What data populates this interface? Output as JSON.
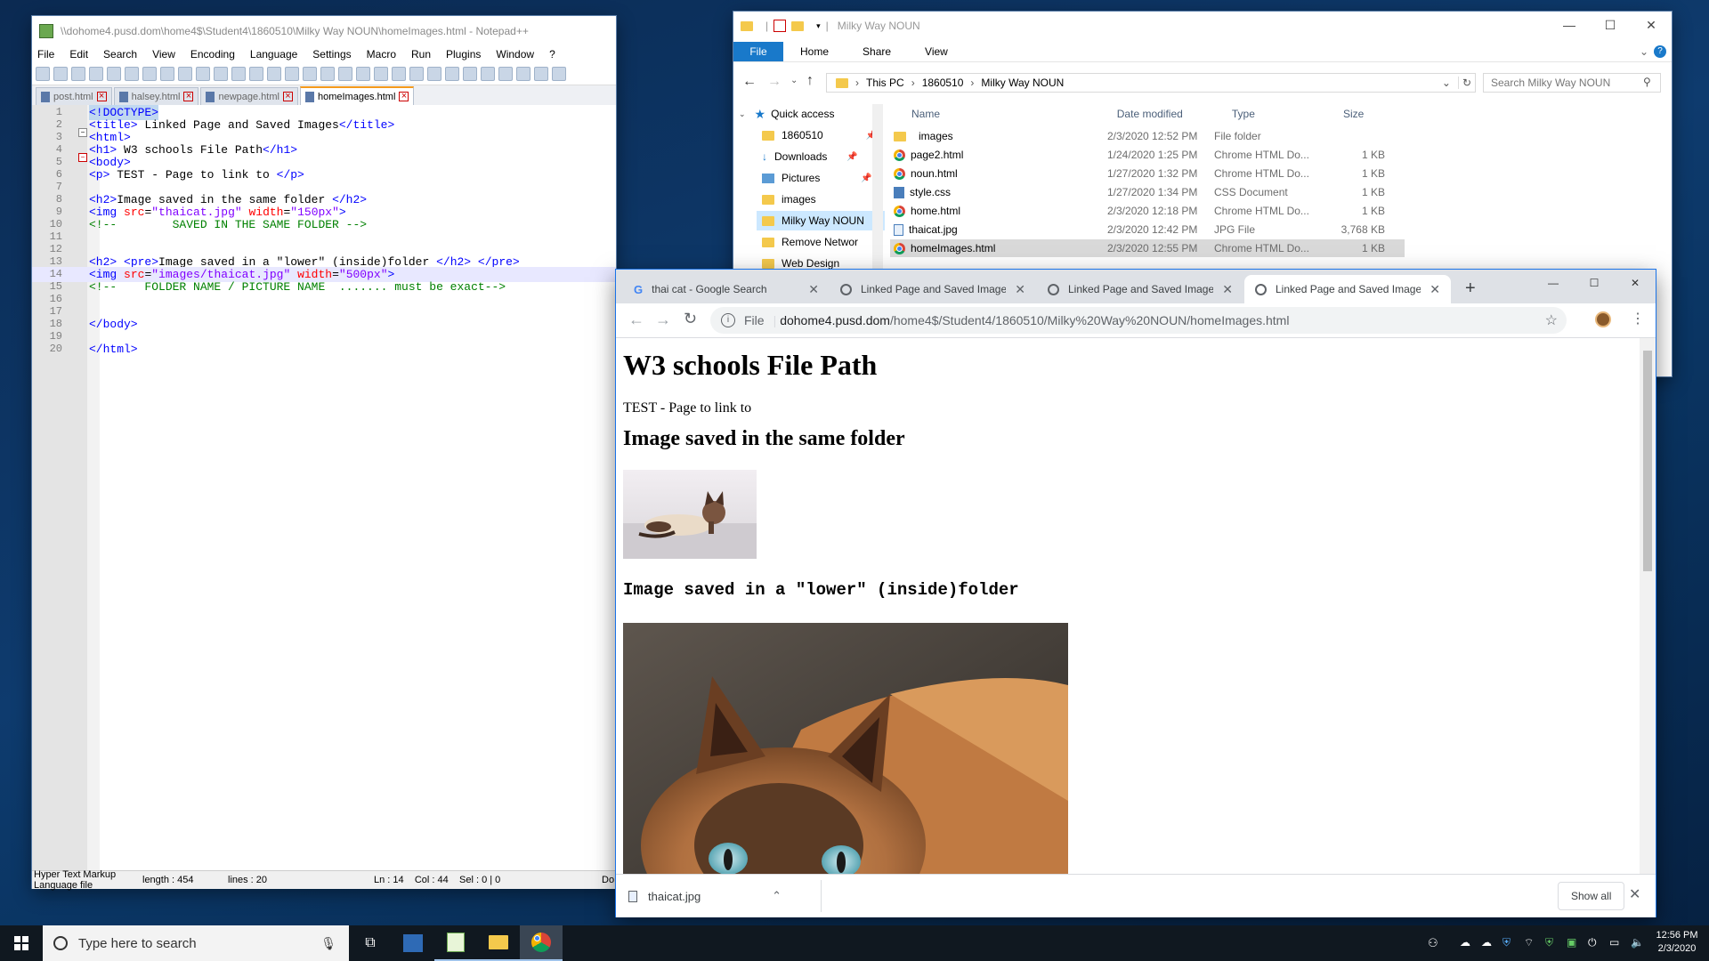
{
  "notepad": {
    "title": "\\\\dohome4.pusd.dom\\home4$\\Student4\\1860510\\Milky Way NOUN\\homeImages.html - Notepad++",
    "menu": [
      "File",
      "Edit",
      "Search",
      "View",
      "Encoding",
      "Language",
      "Settings",
      "Macro",
      "Run",
      "Plugins",
      "Window",
      "?"
    ],
    "tabs": [
      "post.html",
      "halsey.html",
      "newpage.html",
      "homeImages.html"
    ],
    "lines": [
      {
        "n": "1"
      },
      {
        "n": "2"
      },
      {
        "n": "3"
      },
      {
        "n": "4"
      },
      {
        "n": "5"
      },
      {
        "n": "6"
      },
      {
        "n": "7"
      },
      {
        "n": "8"
      },
      {
        "n": "9"
      },
      {
        "n": "10"
      },
      {
        "n": "11"
      },
      {
        "n": "12"
      },
      {
        "n": "13"
      },
      {
        "n": "14"
      },
      {
        "n": "15"
      },
      {
        "n": "16"
      },
      {
        "n": "17"
      },
      {
        "n": "18"
      },
      {
        "n": "19"
      },
      {
        "n": "20"
      }
    ],
    "code": {
      "l1": "<!DOCTYPE>",
      "l2_open": "<title>",
      "l2_text": " Linked Page and Saved Images",
      "l2_close": "</title>",
      "l3": "<html>",
      "l4_open": "<h1>",
      "l4_text": " W3 schools File Path",
      "l4_close": "</h1>",
      "l5": "<body>",
      "l6_open": "<p>",
      "l6_text": " TEST - Page to link to ",
      "l6_close": "</p>",
      "l8_open": "<h2>",
      "l8_text": "Image saved in the same folder ",
      "l8_close": "</h2>",
      "l9_tag": "<img",
      "l9_a1": " src",
      "l9_v1": "\"thaicat.jpg\"",
      "l9_a2": " width",
      "l9_v2": "\"150px\"",
      "l9_end": ">",
      "l10": "<!--        SAVED IN THE SAME FOLDER -->",
      "l13_open": "<h2>",
      "l13_pre": " <pre>",
      "l13_text": "Image saved in a \"lower\" (inside)folder ",
      "l13_close": "</h2>",
      "l13_preclose": " </pre>",
      "l14_tag": "<img",
      "l14_a1": " src",
      "l14_v1": "\"images/thaicat.jpg\"",
      "l14_a2": " width",
      "l14_v2": "\"500px\"",
      "l14_end": ">",
      "l15": "<!--    FOLDER NAME / PICTURE NAME  ....... must be exact-->",
      "l18": "</body>",
      "l20": "</html>",
      "eq": "="
    },
    "status": {
      "type": "Hyper Text Markup Language file",
      "length": "length : 454",
      "lines": "lines : 20",
      "pos": "Ln : 14    Col : 44    Sel : 0 | 0",
      "extra": "Do"
    }
  },
  "explorer": {
    "title": "Milky Way NOUN",
    "ribbon": [
      "File",
      "Home",
      "Share",
      "View"
    ],
    "breadcrumb": [
      "This PC",
      "1860510",
      "Milky Way NOUN"
    ],
    "search_placeholder": "Search Milky Way NOUN",
    "nav": [
      {
        "label": "Quick access"
      },
      {
        "label": "1860510"
      },
      {
        "label": "Downloads"
      },
      {
        "label": "Pictures"
      },
      {
        "label": "images"
      },
      {
        "label": "Milky Way NOUN"
      },
      {
        "label": "Remove Networ"
      },
      {
        "label": "Web Design"
      }
    ],
    "columns": [
      "Name",
      "Date modified",
      "Type",
      "Size"
    ],
    "files": [
      {
        "name": "images",
        "date": "2/3/2020 12:52 PM",
        "type": "File folder",
        "size": ""
      },
      {
        "name": "page2.html",
        "date": "1/24/2020 1:25 PM",
        "type": "Chrome HTML Do...",
        "size": "1 KB"
      },
      {
        "name": "noun.html",
        "date": "1/27/2020 1:32 PM",
        "type": "Chrome HTML Do...",
        "size": "1 KB"
      },
      {
        "name": "style.css",
        "date": "1/27/2020 1:34 PM",
        "type": "CSS Document",
        "size": "1 KB"
      },
      {
        "name": "home.html",
        "date": "2/3/2020 12:18 PM",
        "type": "Chrome HTML Do...",
        "size": "1 KB"
      },
      {
        "name": "thaicat.jpg",
        "date": "2/3/2020 12:42 PM",
        "type": "JPG File",
        "size": "3,768 KB"
      },
      {
        "name": "homeImages.html",
        "date": "2/3/2020 12:55 PM",
        "type": "Chrome HTML Do...",
        "size": "1 KB"
      }
    ]
  },
  "chrome": {
    "tabs": [
      "thai cat - Google Search",
      "Linked Page and Saved Images",
      "Linked Page and Saved Images",
      "Linked Page and Saved Images"
    ],
    "url_scheme": "File",
    "url_host": "dohome4.pusd.dom",
    "url_path": "/home4$/Student4/1860510/Milky%20Way%20NOUN/homeImages.html",
    "page": {
      "h1": "W3 schools File Path",
      "p": "TEST - Page to link to",
      "h2a": "Image saved in the same folder",
      "h2b": "Image saved in a \"lower\" (inside)folder"
    },
    "download": {
      "file": "thaicat.jpg",
      "show_all": "Show all"
    }
  },
  "taskbar": {
    "search_placeholder": "Type here to search",
    "time": "12:56 PM",
    "date": "2/3/2020"
  }
}
